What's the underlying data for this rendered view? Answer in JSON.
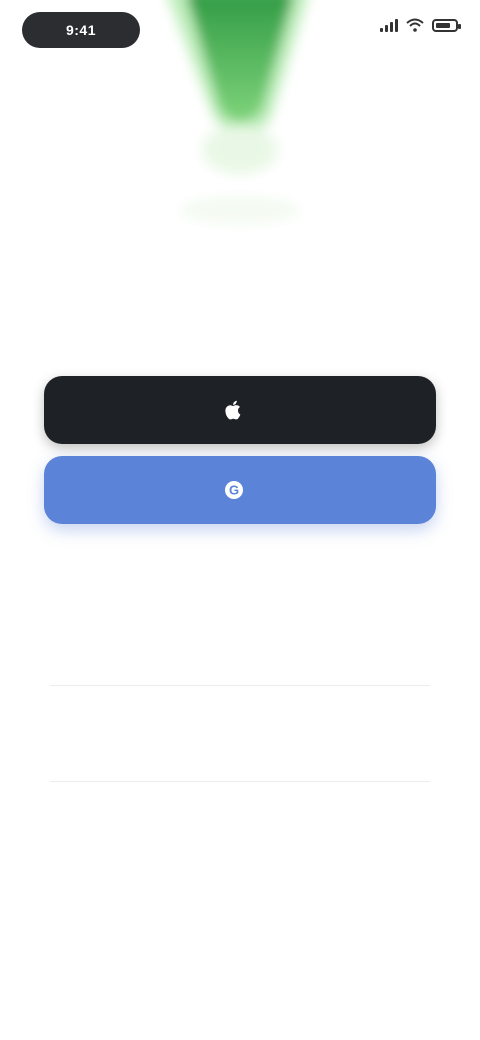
{
  "status_bar": {
    "time": "9:41",
    "battery_level": 0.8
  },
  "hero": {
    "logo_text": "",
    "icon": "balloon-logo-icon",
    "colors": {
      "primary": "#2f9a44",
      "light": "#9fe39c"
    }
  },
  "tagline": "",
  "buttons": {
    "apple": {
      "label": "",
      "icon": "apple-icon",
      "color": "#1e2126"
    },
    "google": {
      "label": "",
      "icon": "google-icon",
      "color": "#5b84d8"
    }
  },
  "divider_text": "",
  "links": {
    "email": "",
    "phone": ""
  }
}
